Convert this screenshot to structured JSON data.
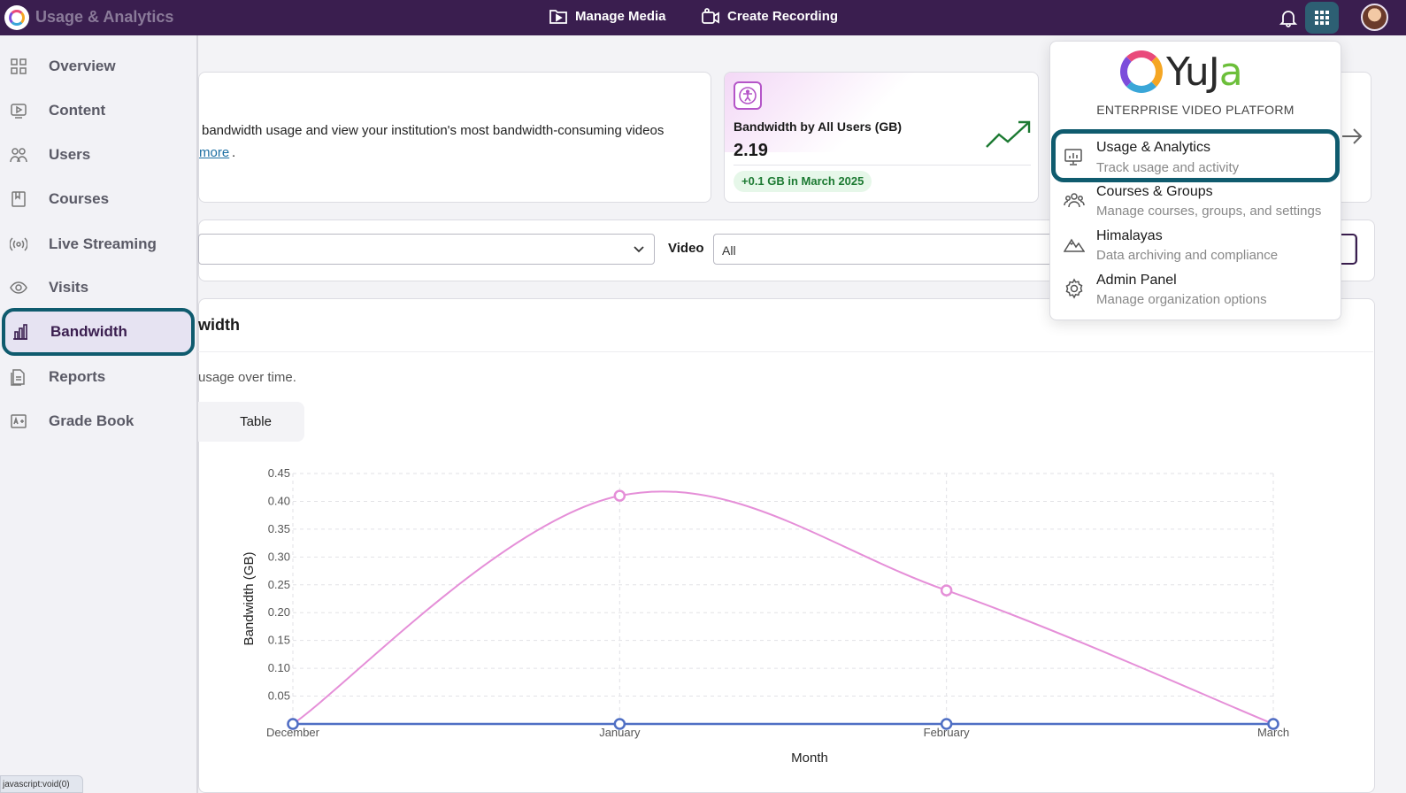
{
  "app": {
    "title": "Usage & Analytics"
  },
  "topbar": {
    "manage_media": "Manage Media",
    "create_recording": "Create Recording"
  },
  "sidebar": {
    "items": [
      {
        "label": "Overview",
        "icon": "overview-grid-icon"
      },
      {
        "label": "Content",
        "icon": "content-play-icon"
      },
      {
        "label": "Users",
        "icon": "users-icon"
      },
      {
        "label": "Courses",
        "icon": "courses-book-icon"
      },
      {
        "label": "Live Streaming",
        "icon": "live-broadcast-icon"
      },
      {
        "label": "Visits",
        "icon": "eye-icon"
      },
      {
        "label": "Bandwidth",
        "icon": "bar-chart-icon",
        "active": true
      },
      {
        "label": "Reports",
        "icon": "reports-document-icon"
      },
      {
        "label": "Grade Book",
        "icon": "grade-book-icon"
      }
    ],
    "status_text": "javascript:void(0)"
  },
  "info_card": {
    "text": "bandwidth usage and view your institution's most bandwidth-consuming videos",
    "link": "more",
    "suffix": "."
  },
  "metric": {
    "title": "Bandwidth by All Users (GB)",
    "value": "2.19",
    "badge": "+0.1 GB in March 2025",
    "accent": "#1c7a32"
  },
  "filters": {
    "video_label": "Video",
    "video_value": "All"
  },
  "chart_panel": {
    "title": "width",
    "description": "usage over time.",
    "tab_table": "Table"
  },
  "app_menu": {
    "brand": "YuJa",
    "subtitle": "ENTERPRISE VIDEO PLATFORM",
    "items": [
      {
        "title": "Usage & Analytics",
        "subtitle": "Track usage and activity",
        "icon": "analytics-presentation-icon",
        "selected": true
      },
      {
        "title": "Courses & Groups",
        "subtitle": "Manage courses, groups, and settings",
        "icon": "groups-icon"
      },
      {
        "title": "Himalayas",
        "subtitle": "Data archiving and compliance",
        "icon": "mountain-icon"
      },
      {
        "title": "Admin Panel",
        "subtitle": "Manage organization options",
        "icon": "gear-icon"
      }
    ]
  },
  "colors": {
    "topbar": "#3a1e4f",
    "highlight": "#0f5b6e",
    "series_pink": "#e58fd8",
    "series_blue": "#4f6fc4"
  },
  "chart_data": {
    "type": "line",
    "categories": [
      "December",
      "January",
      "February",
      "March"
    ],
    "xlabel": "Month",
    "ylabel": "Bandwidth (GB)",
    "ylim": [
      0,
      0.45
    ],
    "yticks": [
      "0.05",
      "0.10",
      "0.15",
      "0.20",
      "0.25",
      "0.30",
      "0.35",
      "0.40",
      "0.45"
    ],
    "grid": true,
    "series": [
      {
        "values": [
          0,
          0.41,
          0.24,
          0
        ],
        "color": "#e58fd8"
      },
      {
        "values": [
          0,
          0,
          0,
          0
        ],
        "color": "#4f6fc4"
      }
    ]
  }
}
